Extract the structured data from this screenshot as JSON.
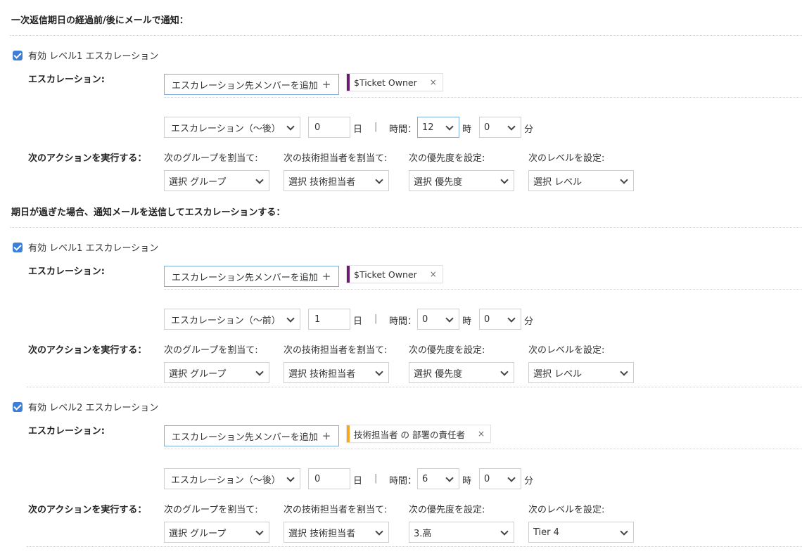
{
  "sections": [
    {
      "title": "一次返信期日の経過前/後にメールで通知：",
      "levels": [
        {
          "checkbox_label": "有効 レベル1 エスカレーション",
          "escalation_label": "エスカレーション:",
          "add_member_label": "エスカレーション先メンバーを追加",
          "chip": {
            "text": "$Ticket Owner",
            "color": "#6a1b6e"
          },
          "timing_select": "エスカレーション（〜後）",
          "days_value": "0",
          "day_unit": "日",
          "time_label": "時間：",
          "hour_value": "12",
          "hour_unit": "時",
          "minute_value": "0",
          "minute_unit": "分",
          "action_label": "次のアクションを実行する：",
          "actions": [
            {
              "label": "次のグループを割当て:",
              "value": "選択 グループ"
            },
            {
              "label": "次の技術担当者を割当て:",
              "value": "選択 技術担当者"
            },
            {
              "label": "次の優先度を設定:",
              "value": "選択 優先度"
            },
            {
              "label": "次のレベルを設定:",
              "value": "選択 レベル"
            }
          ]
        }
      ]
    },
    {
      "title": "期日が過ぎた場合、通知メールを送信してエスカレーションする：",
      "levels": [
        {
          "checkbox_label": "有効 レベル1 エスカレーション",
          "escalation_label": "エスカレーション:",
          "add_member_label": "エスカレーション先メンバーを追加",
          "chip": {
            "text": "$Ticket Owner",
            "color": "#6a1b6e"
          },
          "timing_select": "エスカレーション（〜前）",
          "days_value": "1",
          "day_unit": "日",
          "time_label": "時間：",
          "hour_value": "0",
          "hour_unit": "時",
          "minute_value": "0",
          "minute_unit": "分",
          "action_label": "次のアクションを実行する：",
          "actions": [
            {
              "label": "次のグループを割当て:",
              "value": "選択 グループ"
            },
            {
              "label": "次の技術担当者を割当て:",
              "value": "選択 技術担当者"
            },
            {
              "label": "次の優先度を設定:",
              "value": "選択 優先度"
            },
            {
              "label": "次のレベルを設定:",
              "value": "選択 レベル"
            }
          ]
        },
        {
          "checkbox_label": "有効 レベル2 エスカレーション",
          "escalation_label": "エスカレーション:",
          "add_member_label": "エスカレーション先メンバーを追加",
          "chip": {
            "text": "技術担当者 の 部署の責任者",
            "color": "#f5a623"
          },
          "timing_select": "エスカレーション（〜後）",
          "days_value": "0",
          "day_unit": "日",
          "time_label": "時間：",
          "hour_value": "6",
          "hour_unit": "時",
          "minute_value": "0",
          "minute_unit": "分",
          "action_label": "次のアクションを実行する：",
          "actions": [
            {
              "label": "次のグループを割当て:",
              "value": "選択 グループ"
            },
            {
              "label": "次の技術担当者を割当て:",
              "value": "選択 技術担当者"
            },
            {
              "label": "次の優先度を設定:",
              "value": "3.高"
            },
            {
              "label": "次のレベルを設定:",
              "value": "Tier 4"
            }
          ]
        }
      ]
    }
  ],
  "icons": {
    "add": "plus-icon",
    "remove": "close-icon",
    "dropdown": "chevron-down-icon",
    "checkbox": "check-icon"
  }
}
